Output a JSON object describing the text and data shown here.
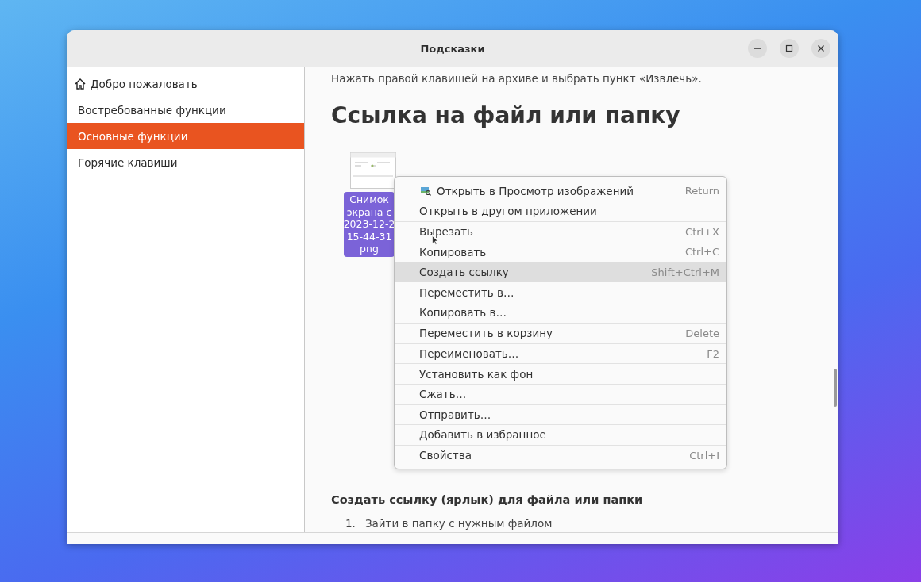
{
  "window": {
    "title": "Подсказки"
  },
  "sidebar": {
    "items": [
      {
        "label": "Добро пожаловать",
        "kind": "home",
        "selected": false
      },
      {
        "label": "Востребованные функции",
        "kind": "plain",
        "selected": false
      },
      {
        "label": "Основные функции",
        "kind": "plain",
        "selected": true
      },
      {
        "label": "Горячие клавиши",
        "kind": "plain",
        "selected": false
      }
    ]
  },
  "content": {
    "intro": "Нажать правой клавишей на архиве и выбрать пункт «Извлечь».",
    "heading": "Ссылка на файл или папку",
    "file": {
      "label_lines": [
        "Снимок",
        "экрана с",
        "2023-12-2",
        "15-44-31",
        "png"
      ],
      "selected": true
    },
    "subheading": "Создать ссылку (ярлык) для файла или папки",
    "steps": [
      {
        "number": "1.",
        "text": "Зайти в папку с нужным файлом"
      }
    ]
  },
  "context_menu": {
    "items": [
      {
        "label": "Открыть в Просмотр изображений",
        "shortcut": "Return",
        "icon": true,
        "separator_before": false,
        "selected": false
      },
      {
        "label": "Открыть в другом приложении",
        "separator_before": false,
        "selected": false
      },
      {
        "label": "Вырезать",
        "shortcut": "Ctrl+X",
        "separator_before": true,
        "selected": false
      },
      {
        "label": "Копировать",
        "shortcut": "Ctrl+C",
        "separator_before": false,
        "selected": false
      },
      {
        "label": "Создать ссылку",
        "shortcut": "Shift+Ctrl+M",
        "separator_before": false,
        "selected": true
      },
      {
        "label": "Переместить в…",
        "separator_before": false,
        "selected": false
      },
      {
        "label": "Копировать в…",
        "separator_before": false,
        "selected": false
      },
      {
        "label": "Переместить в корзину",
        "shortcut": "Delete",
        "separator_before": true,
        "selected": false
      },
      {
        "label": "Переименовать…",
        "shortcut": "F2",
        "separator_before": true,
        "selected": false
      },
      {
        "label": "Установить как фон",
        "separator_before": true,
        "selected": false
      },
      {
        "label": "Сжать…",
        "separator_before": true,
        "selected": false
      },
      {
        "label": "Отправить…",
        "separator_before": true,
        "selected": false
      },
      {
        "label": "Добавить в избранное",
        "separator_before": true,
        "selected": false
      },
      {
        "label": "Свойства",
        "shortcut": "Ctrl+I",
        "separator_before": true,
        "selected": false
      }
    ]
  }
}
